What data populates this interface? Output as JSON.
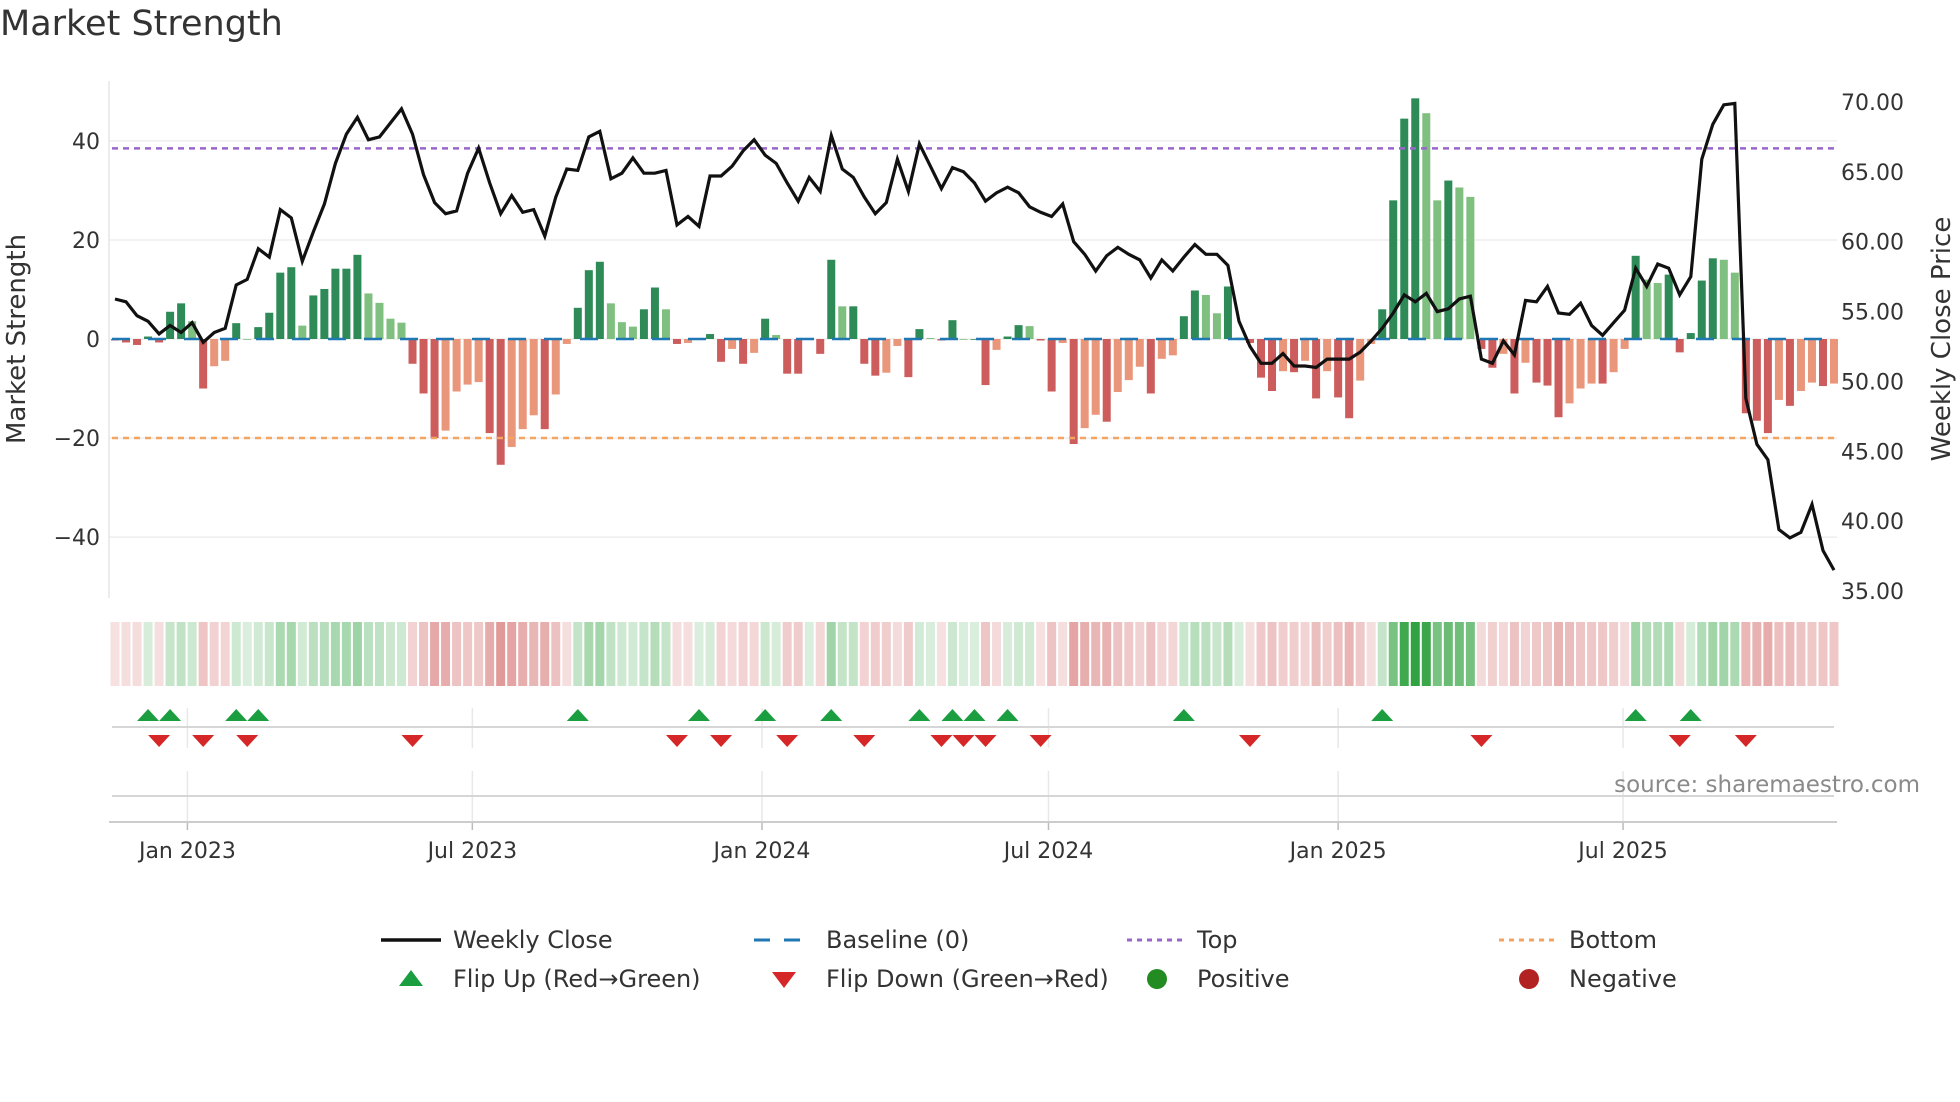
{
  "title": "Market Strength",
  "source": "source: sharemaestro.com",
  "colors": {
    "pos_strong": "#2e8b57",
    "pos_weak": "#7fbf7f",
    "neg_strong": "#cd5c5c",
    "neg_weak": "#e9967a",
    "heat_pos": "44,160,60",
    "heat_neg": "205,85,85",
    "close": "#111111",
    "baseline": "#1f77b4",
    "top": "#9966cc",
    "bottom": "#f4a460",
    "flip_up": "#1a9e3f",
    "flip_down": "#d62728",
    "positive": "#228b22",
    "negative": "#b22222"
  },
  "chart_data": {
    "type": "bar",
    "title": "Market Strength",
    "ylabel": "Market Strength",
    "y2label": "Weekly Close Price",
    "ylim": [
      -52.3,
      52.1
    ],
    "y2lim": [
      34.5,
      71.5
    ],
    "yticks": [
      "40",
      "20",
      "0",
      "−20",
      "−40"
    ],
    "ytick_values": [
      40,
      20,
      0,
      -20,
      -40
    ],
    "y2ticks": [
      "70.00",
      "65.00",
      "60.00",
      "55.00",
      "50.00",
      "45.00",
      "40.00",
      "35.00"
    ],
    "y2tick_values": [
      70,
      65,
      60,
      55,
      50,
      45,
      40,
      35
    ],
    "xticks": [
      {
        "label": "Jan 2023",
        "date": "2023-01-01"
      },
      {
        "label": "Jul 2023",
        "date": "2023-07-01"
      },
      {
        "label": "Jan 2024",
        "date": "2024-01-01"
      },
      {
        "label": "Jul 2024",
        "date": "2024-07-01"
      },
      {
        "label": "Jan 2025",
        "date": "2025-01-01"
      },
      {
        "label": "Jul 2025",
        "date": "2025-07-01"
      }
    ],
    "start_date": "2022-11-16",
    "interval": "weekly",
    "top": 38.5,
    "bottom": -20,
    "baseline": 0,
    "strength": [
      -0.3,
      -0.7,
      -1.2,
      0.5,
      -0.7,
      5.5,
      7.2,
      3.6,
      -10,
      -5.5,
      -4.4,
      3.2,
      0,
      2.4,
      5.3,
      13.4,
      14.5,
      2.7,
      8.8,
      10.1,
      14.2,
      14.2,
      17,
      9.2,
      7.3,
      4.1,
      3.3,
      -5,
      -11,
      -20,
      -18.5,
      -10.6,
      -9.2,
      -8.7,
      -19,
      -25.4,
      -21.8,
      -18.2,
      -15.4,
      -18.2,
      -11.2,
      -1,
      6.3,
      13.9,
      15.6,
      7.2,
      3.4,
      2.5,
      6,
      10.4,
      6,
      -1,
      -0.8,
      0,
      1,
      -4.6,
      -2,
      -5,
      -2.8,
      4.1,
      0.8,
      -7,
      -7,
      0,
      -3,
      16,
      6.6,
      6.6,
      -5,
      -7.4,
      -6.8,
      -1.4,
      -7.7,
      2,
      0.2,
      -0.3,
      3.8,
      0,
      0,
      -9.3,
      -2.2,
      0.5,
      2.8,
      2.6,
      -0.3,
      -10.6,
      -0.8,
      -21.2,
      -18,
      -15.3,
      -16.7,
      -10.7,
      -8.3,
      -5.6,
      -11,
      -4,
      -3.3,
      4.6,
      9.8,
      8.9,
      5.2,
      10.6,
      0.3,
      -0.8,
      -7.8,
      -10.5,
      -6.5,
      -6.7,
      -4.4,
      -12,
      -6.5,
      -11.8,
      -16,
      -8.4,
      -1,
      6,
      28,
      44.5,
      48.6,
      45.6,
      28,
      32,
      30.6,
      28.7,
      -2,
      -5.8,
      -3,
      -11,
      -4.8,
      -8.8,
      -9.4,
      -15.8,
      -13,
      -10,
      -9,
      -9,
      -6.7,
      -2,
      16.8,
      12,
      11.3,
      13,
      -2.7,
      1.2,
      11.8,
      16.3,
      16,
      13.4,
      -15,
      -16.5,
      -19,
      -12.3,
      -13.5,
      -10.5,
      -8.8,
      -9.5,
      -9
    ],
    "close": [
      55.9,
      55.7,
      54.7,
      54.3,
      53.4,
      54.0,
      53.5,
      54.2,
      52.8,
      53.5,
      53.8,
      56.9,
      57.3,
      59.5,
      58.9,
      62.3,
      61.7,
      58.6,
      60.7,
      62.7,
      65.6,
      67.7,
      68.9,
      67.3,
      67.5,
      68.5,
      69.5,
      67.7,
      64.8,
      62.8,
      62.0,
      62.2,
      64.9,
      66.7,
      64.2,
      62.0,
      63.3,
      62.1,
      62.3,
      60.4,
      63.2,
      65.2,
      65.1,
      67.5,
      67.9,
      64.5,
      64.9,
      66.0,
      64.9,
      64.9,
      65.1,
      61.2,
      61.8,
      61.1,
      64.7,
      64.7,
      65.4,
      66.5,
      67.3,
      66.2,
      65.6,
      64.2,
      62.9,
      64.6,
      63.6,
      67.6,
      65.2,
      64.6,
      63.2,
      62.0,
      62.8,
      65.9,
      63.6,
      67.0,
      65.4,
      63.8,
      65.3,
      65.0,
      64.2,
      62.9,
      63.5,
      63.9,
      63.5,
      62.5,
      62.1,
      61.8,
      62.7,
      60.0,
      59.1,
      57.9,
      59.0,
      59.6,
      59.1,
      58.7,
      57.4,
      58.7,
      57.9,
      58.9,
      59.8,
      59.1,
      59.1,
      58.3,
      54.3,
      52.5,
      51.3,
      51.3,
      52.0,
      51.1,
      51.1,
      51.0,
      51.6,
      51.6,
      51.6,
      52.1,
      52.9,
      53.8,
      54.9,
      56.2,
      55.7,
      56.3,
      55.0,
      55.2,
      55.9,
      56.1,
      51.6,
      51.3,
      52.9,
      51.9,
      55.8,
      55.7,
      56.8,
      54.9,
      54.8,
      55.6,
      54.0,
      53.3,
      54.2,
      55.1,
      58.1,
      56.8,
      58.4,
      58.1,
      56.2,
      57.5,
      65.9,
      68.4,
      69.8,
      69.9,
      48.8,
      45.5,
      44.4,
      39.4,
      38.8,
      39.2,
      41.2,
      37.9,
      36.5
    ],
    "flip_up_indices": [
      3,
      5,
      11,
      13,
      42,
      53,
      59,
      65,
      73,
      76,
      78,
      81,
      97,
      115,
      138,
      143
    ],
    "flip_down_indices": [
      4,
      8,
      12,
      27,
      51,
      55,
      61,
      68,
      75,
      77,
      79,
      84,
      103,
      124,
      142,
      148
    ],
    "legend": {
      "weekly_close": "Weekly Close",
      "baseline": "Baseline (0)",
      "top": "Top",
      "bottom": "Bottom",
      "flip_up": "Flip Up (Red→Green)",
      "flip_down": "Flip Down (Green→Red)",
      "positive": "Positive",
      "negative": "Negative"
    },
    "legend_position": "bottom"
  }
}
